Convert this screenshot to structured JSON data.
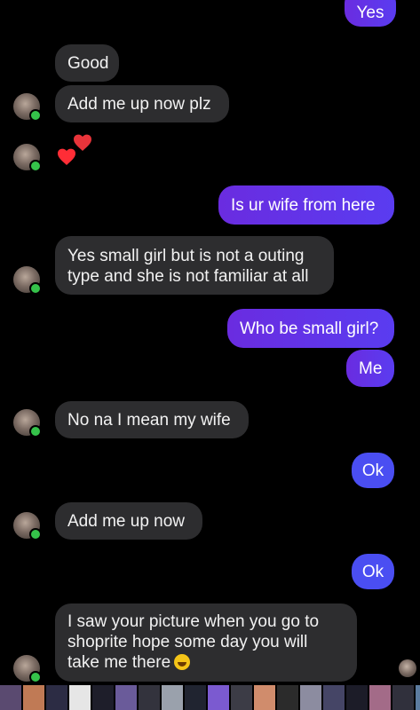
{
  "messages": {
    "yes_partial": "Yes",
    "good": "Good",
    "add_me_plz": "Add me up now plz",
    "is_ur_wife": "Is ur wife from here",
    "yes_small_girl_l1": "Yes small girl but is not a outing",
    "yes_small_girl_l2": "type and she is not familiar at all",
    "who_be_small_girl": "Who be small girl?",
    "me": "Me",
    "no_na": "No na I mean my wife",
    "ok1": "Ok",
    "add_me_now": "Add me up now",
    "ok2": "Ok",
    "saw_picture_l1": "I saw your picture when you go to",
    "saw_picture_l2": "shoprite hope some day you will",
    "saw_picture_l3": "take me there"
  },
  "icons": {
    "hearts": "two-hearts-emoji",
    "laugh": "rolling-on-floor-laughing-emoji"
  },
  "colors": {
    "background": "#000000",
    "incoming_bubble": "#2d2d2f",
    "outgoing_bubble_start": "#6a2ce0",
    "outgoing_bubble_end": "#5a3cf0",
    "outgoing_blue": "#4a4ef2",
    "online_dot": "#35c24a"
  }
}
